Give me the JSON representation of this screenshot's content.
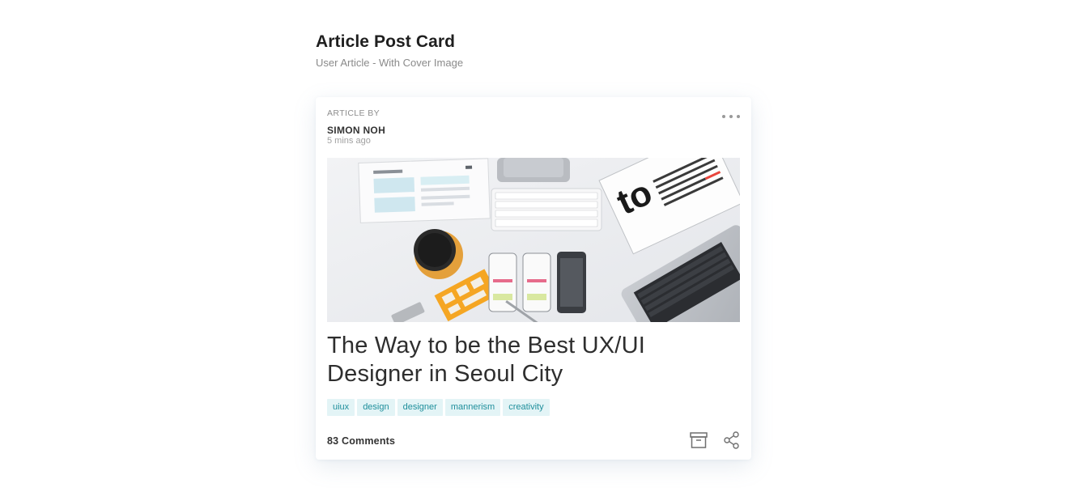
{
  "header": {
    "title": "Article Post Card",
    "subtitle": "User Article - With Cover Image"
  },
  "card": {
    "author": {
      "label": "ARTICLE BY",
      "name": "SIMON NOH",
      "time": "5 mins ago"
    },
    "more_icon": "ellipsis-icon",
    "cover_image": "desk-workspace-photo",
    "title_line1": "The Way to be the Best UX/UI",
    "title_line2": "Designer in Seoul City",
    "tags": [
      "uiux",
      "design",
      "designer",
      "mannerism",
      "creativity"
    ],
    "comments": "83 Comments",
    "actions": [
      "archive-icon",
      "share-icon"
    ]
  },
  "colors": {
    "tag_bg": "#e3f4f6",
    "tag_text": "#1f8f9c",
    "accent_book": "#e8453c",
    "accent_tool": "#f5a623"
  }
}
